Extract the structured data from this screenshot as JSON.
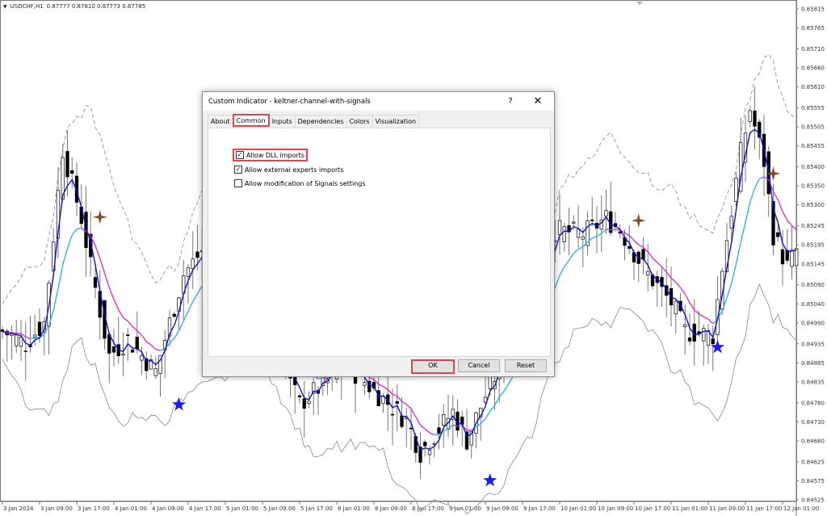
{
  "symbol_bar": {
    "symbol": "USDCHF,H1",
    "ohlc": "0.87777 0.87810 0.87773 0.87785"
  },
  "colors": {
    "fast_line": "#1010e0",
    "slow_rising": "#19b6f0",
    "slow_falling": "#ee1fd0",
    "band": "#888888",
    "buy_star": "#1a1aff",
    "sell_star": "#8b4a1c",
    "highlight": "#e8414b"
  },
  "chart_data": {
    "type": "candlestick",
    "price_axis": [
      "0.85815",
      "0.85765",
      "0.85710",
      "0.85660",
      "0.85610",
      "0.85555",
      "0.85505",
      "0.85455",
      "0.85400",
      "0.85350",
      "0.85300",
      "0.85245",
      "0.85195",
      "0.85145",
      "0.85090",
      "0.85040",
      "0.84990",
      "0.84935",
      "0.84885",
      "0.84835",
      "0.84780",
      "0.84730",
      "0.84680",
      "0.84625",
      "0.84575",
      "0.84525"
    ],
    "ylim": [
      0.84525,
      0.85815
    ],
    "time_axis": [
      "3 Jan 2024",
      "3 Jan 09:00",
      "3 Jan 17:00",
      "4 Jan 01:00",
      "4 Jan 09:00",
      "4 Jan 17:00",
      "5 Jan 01:00",
      "5 Jan 09:00",
      "5 Jan 17:00",
      "8 Jan 01:00",
      "8 Jan 09:00",
      "8 Jan 17:00",
      "9 Jan 01:00",
      "9 Jan 09:00",
      "9 Jan 17:00",
      "10 Jan 01:00",
      "10 Jan 09:00",
      "10 Jan 17:00",
      "11 Jan 01:00",
      "11 Jan 09:00",
      "11 Jan 17:00",
      "12 Jan 01:00"
    ],
    "bars_per_time_label": 8,
    "price_path": [
      [
        0,
        0.84968
      ],
      [
        5,
        0.84936
      ],
      [
        9,
        0.8499
      ],
      [
        13,
        0.85446
      ],
      [
        17,
        0.85265
      ],
      [
        19,
        0.85138
      ],
      [
        23,
        0.84905
      ],
      [
        27,
        0.84947
      ],
      [
        33,
        0.84862
      ],
      [
        36,
        0.8499
      ],
      [
        39,
        0.85117
      ],
      [
        43,
        0.8518
      ],
      [
        52,
        0.851
      ],
      [
        64,
        0.84777
      ],
      [
        74,
        0.8488
      ],
      [
        87,
        0.84735
      ],
      [
        90,
        0.8465
      ],
      [
        97,
        0.84756
      ],
      [
        100,
        0.84682
      ],
      [
        104,
        0.84799
      ],
      [
        107,
        0.84873
      ],
      [
        113,
        0.85032
      ],
      [
        119,
        0.85234
      ],
      [
        125,
        0.85223
      ],
      [
        130,
        0.85265
      ],
      [
        133,
        0.85234
      ],
      [
        139,
        0.85117
      ],
      [
        144,
        0.85043
      ],
      [
        147,
        0.84968
      ],
      [
        153,
        0.84958
      ],
      [
        155,
        0.85138
      ],
      [
        159,
        0.85435
      ],
      [
        161,
        0.85552
      ],
      [
        164,
        0.85414
      ],
      [
        166,
        0.85223
      ],
      [
        169,
        0.85138
      ],
      [
        171,
        0.85181
      ]
    ],
    "signals": [
      {
        "type": "buy",
        "bar": 38,
        "price": 0.84775
      },
      {
        "type": "buy",
        "bar": 105,
        "price": 0.84576
      },
      {
        "type": "buy",
        "bar": 154,
        "price": 0.84926
      },
      {
        "type": "sell",
        "bar": 21,
        "price": 0.85268
      },
      {
        "type": "sell",
        "bar": 137,
        "price": 0.85259
      },
      {
        "type": "sell",
        "bar": 166,
        "price": 0.85382
      }
    ]
  },
  "dialog": {
    "title": "Custom Indicator - keltner-channel-with-signals",
    "help": "?",
    "close": "✕",
    "tabs": [
      "About",
      "Common",
      "Inputs",
      "Dependencies",
      "Colors",
      "Visualization"
    ],
    "active_tab": "Common",
    "options": [
      {
        "label": "Allow DLL imports",
        "checked": true
      },
      {
        "label": "Allow external experts imports",
        "checked": true
      },
      {
        "label": "Allow modification of Signals settings",
        "checked": false
      }
    ],
    "buttons": {
      "ok": "OK",
      "cancel": "Cancel",
      "reset": "Reset"
    }
  }
}
